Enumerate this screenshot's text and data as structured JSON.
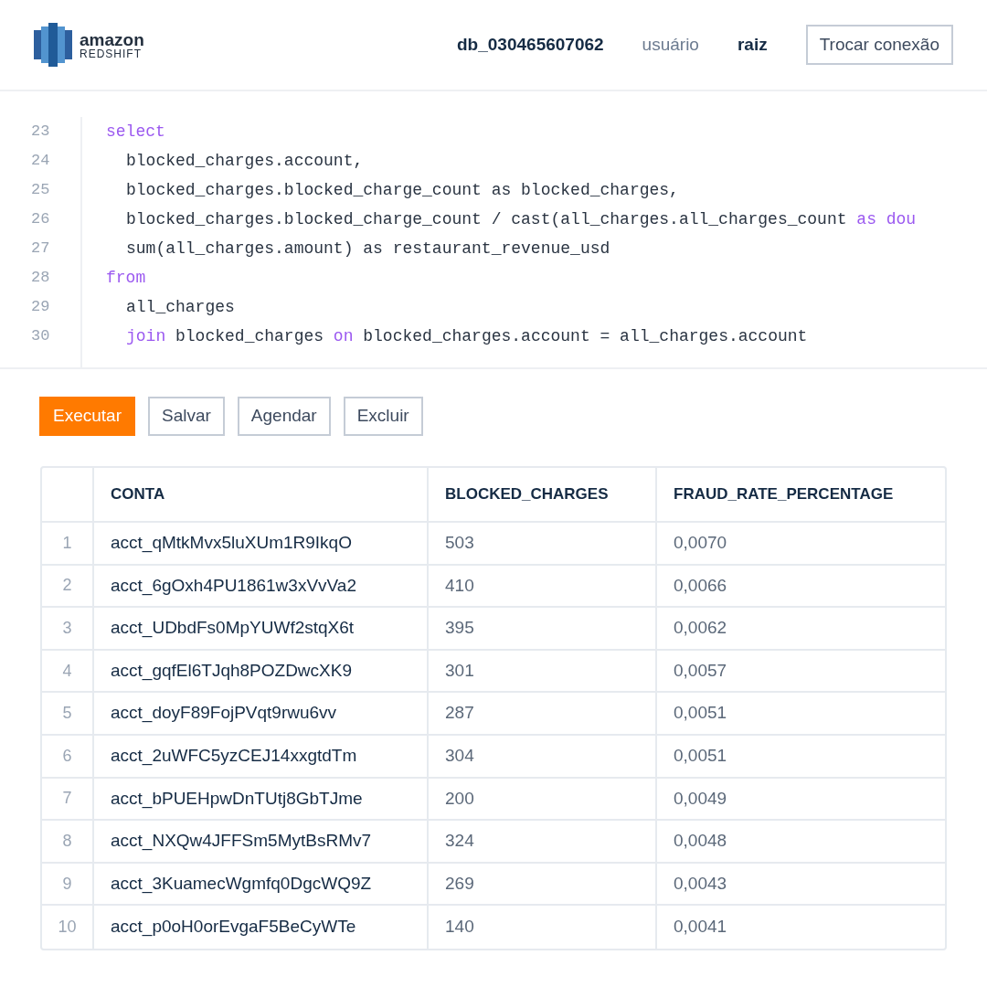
{
  "header": {
    "logo": {
      "line1": "amazon",
      "line2": "REDSHIFT"
    },
    "database": "db_030465607062",
    "user_label": "usuário",
    "user": "raiz",
    "switch_button": "Trocar conexão"
  },
  "editor": {
    "lines": [
      {
        "number": "23",
        "indented": false,
        "segments": [
          {
            "text": "select",
            "keyword": true
          }
        ]
      },
      {
        "number": "24",
        "indented": true,
        "segments": [
          {
            "text": "blocked_charges.account,",
            "keyword": false
          }
        ]
      },
      {
        "number": "25",
        "indented": true,
        "segments": [
          {
            "text": "blocked_charges.blocked_charge_count as blocked_charges,",
            "keyword": false
          }
        ]
      },
      {
        "number": "26",
        "indented": true,
        "segments": [
          {
            "text": "blocked_charges.blocked_charge_count / cast(all_charges.all_charges_count ",
            "keyword": false
          },
          {
            "text": "as dou",
            "keyword": true
          }
        ]
      },
      {
        "number": "27",
        "indented": true,
        "segments": [
          {
            "text": "sum(all_charges.amount) as restaurant_revenue_usd",
            "keyword": false
          }
        ]
      },
      {
        "number": "28",
        "indented": false,
        "segments": [
          {
            "text": "from",
            "keyword": true
          }
        ]
      },
      {
        "number": "29",
        "indented": true,
        "segments": [
          {
            "text": "all_charges",
            "keyword": false
          }
        ]
      },
      {
        "number": "30",
        "indented": true,
        "segments": [
          {
            "text": "join",
            "keyword": true
          },
          {
            "text": " blocked_charges ",
            "keyword": false
          },
          {
            "text": "on",
            "keyword": true
          },
          {
            "text": " blocked_charges.account = all_charges.account",
            "keyword": false
          }
        ]
      }
    ]
  },
  "actions": [
    {
      "label": "Executar",
      "kind": "primary"
    },
    {
      "label": "Salvar",
      "kind": "secondary"
    },
    {
      "label": "Agendar",
      "kind": "secondary"
    },
    {
      "label": "Excluir",
      "kind": "secondary"
    }
  ],
  "table": {
    "columns": [
      "CONTA",
      "BLOCKED_CHARGES",
      "FRAUD_RATE_PERCENTAGE"
    ],
    "rows": [
      {
        "index": "1",
        "cells": [
          "acct_qMtkMvx5luXUm1R9IkqO",
          "503",
          "0,0070"
        ]
      },
      {
        "index": "2",
        "cells": [
          "acct_6gOxh4PU1861w3xVvVa2",
          "410",
          "0,0066"
        ]
      },
      {
        "index": "3",
        "cells": [
          "acct_UDbdFs0MpYUWf2stqX6t",
          "395",
          "0,0062"
        ]
      },
      {
        "index": "4",
        "cells": [
          "acct_gqfEl6TJqh8POZDwcXK9",
          "301",
          "0,0057"
        ]
      },
      {
        "index": "5",
        "cells": [
          "acct_doyF89FojPVqt9rwu6vv",
          "287",
          "0,0051"
        ]
      },
      {
        "index": "6",
        "cells": [
          "acct_2uWFC5yzCEJ14xxgtdTm",
          "304",
          "0,0051"
        ]
      },
      {
        "index": "7",
        "cells": [
          "acct_bPUEHpwDnTUtj8GbTJme",
          "200",
          "0,0049"
        ]
      },
      {
        "index": "8",
        "cells": [
          "acct_NXQw4JFFSm5MytBsRMv7",
          "324",
          "0,0048"
        ]
      },
      {
        "index": "9",
        "cells": [
          "acct_3KuamecWgmfq0DgcWQ9Z",
          "269",
          "0,0043"
        ]
      },
      {
        "index": "10",
        "cells": [
          "acct_p0oH0orEvgaF5BeCyWTe",
          "140",
          "0,0041"
        ]
      }
    ]
  }
}
